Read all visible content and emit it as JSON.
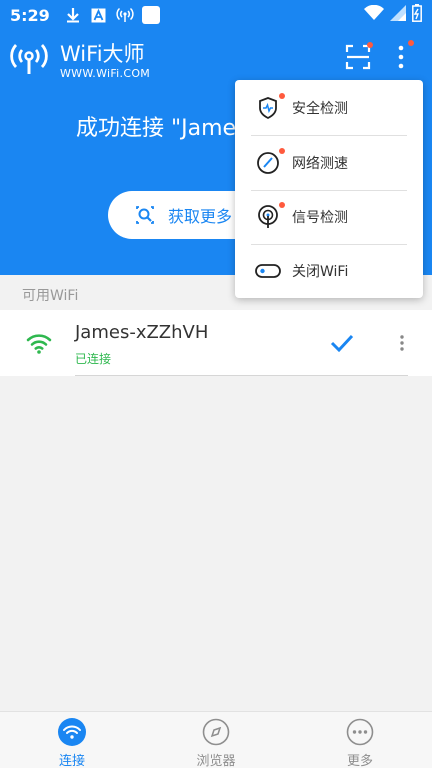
{
  "status_bar": {
    "time": "5:29"
  },
  "header": {
    "title": "WiFi大师",
    "subtitle": "WWW.WiFi.COM",
    "connected_text": "成功连接 \"James-xZZhVH\"",
    "get_more_label": "获取更多"
  },
  "popup_menu": {
    "items": [
      {
        "label": "安全检测",
        "icon": "shield-icon"
      },
      {
        "label": "网络测速",
        "icon": "speedometer-icon"
      },
      {
        "label": "信号检测",
        "icon": "signal-tower-icon"
      },
      {
        "label": "关闭WiFi",
        "icon": "toggle-off-icon"
      }
    ]
  },
  "section_label": "可用WiFi",
  "networks": [
    {
      "ssid": "James-xZZhVH",
      "status": "已连接"
    }
  ],
  "bottom_nav": [
    {
      "label": "连接",
      "icon": "wifi-icon",
      "active": true
    },
    {
      "label": "浏览器",
      "icon": "compass-icon",
      "active": false
    },
    {
      "label": "更多",
      "icon": "more-dots-icon",
      "active": false
    }
  ],
  "colors": {
    "brand": "#1a86f2",
    "connected": "#2fb84f",
    "notification_dot": "#ff5a3d"
  }
}
